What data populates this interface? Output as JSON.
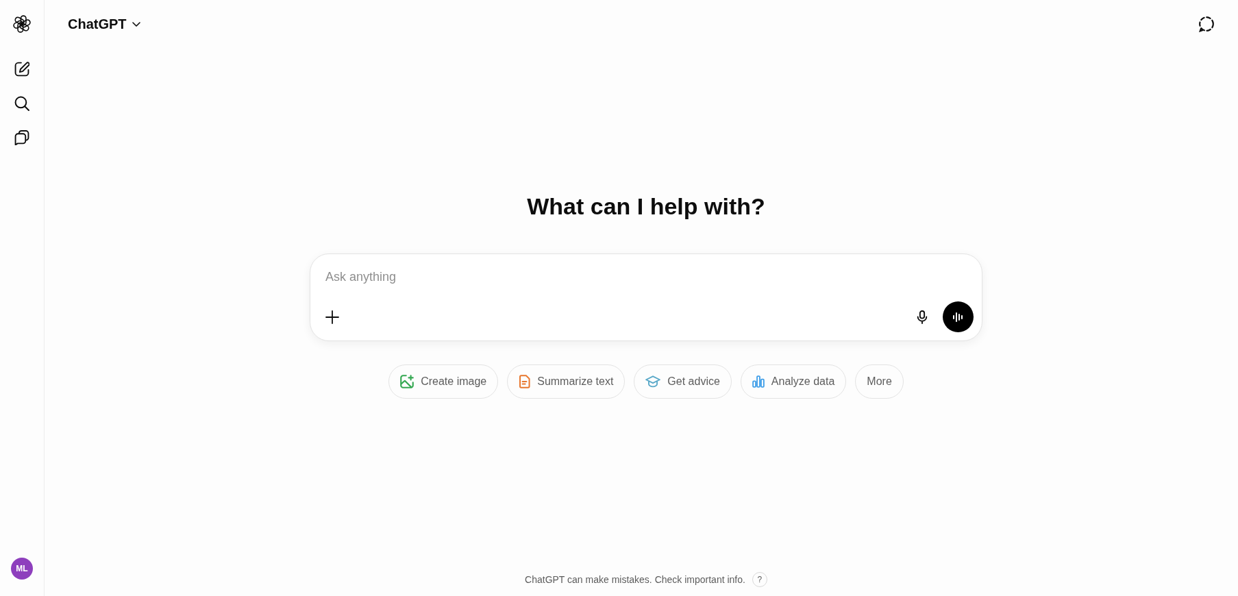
{
  "header": {
    "title": "ChatGPT"
  },
  "sidebar": {
    "avatar": "ML"
  },
  "main": {
    "heading": "What can I help with?",
    "composer": {
      "placeholder": "Ask anything"
    },
    "suggestions": [
      {
        "kind": "image",
        "label": "Create image"
      },
      {
        "kind": "summarize",
        "label": "Summarize text"
      },
      {
        "kind": "advice",
        "label": "Get advice"
      },
      {
        "kind": "analyze",
        "label": "Analyze data"
      },
      {
        "kind": "more",
        "label": "More"
      }
    ]
  },
  "footer": {
    "disclaimer": "ChatGPT can make mistakes. Check important info.",
    "help": "?"
  }
}
